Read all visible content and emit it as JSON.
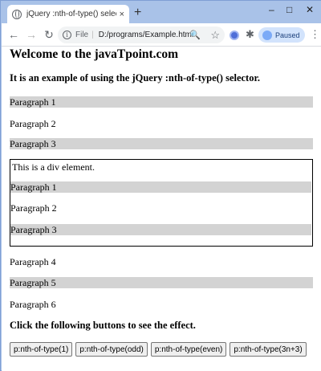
{
  "browser": {
    "tab_title": "jQuery :nth-of-type() selector",
    "tab_close": "×",
    "new_tab": "+",
    "window_controls": {
      "minimize": "–",
      "maximize": "□",
      "close": "✕"
    },
    "nav": {
      "back": "←",
      "forward": "→",
      "reload": "↻"
    },
    "address_scheme": "File",
    "address_separator": "|",
    "address_path": "D:/programs/Example.html",
    "zoom_icon": "🔍",
    "bookmark_icon": "☆",
    "extension_icon": "✱",
    "profile_status": "Paused",
    "menu_icon": "⋮"
  },
  "page": {
    "heading": "Welcome to the javaTpoint.com",
    "subheading": "It is an example of using the jQuery :nth-of-type() selector.",
    "outer_paragraphs": [
      "Paragraph 1",
      "Paragraph 2",
      "Paragraph 3"
    ],
    "div_text": "This is a div element.",
    "div_paragraphs": [
      "Paragraph 1",
      "Paragraph 2",
      "Paragraph 3"
    ],
    "after_paragraphs": [
      "Paragraph 4",
      "Paragraph 5",
      "Paragraph 6"
    ],
    "instruction": "Click the following buttons to see the effect.",
    "buttons": [
      "p:nth-of-type(1)",
      "p:nth-of-type(odd)",
      "p:nth-of-type(even)",
      "p:nth-of-type(3n+3)"
    ],
    "highlight_color": "#d3d3d3"
  }
}
